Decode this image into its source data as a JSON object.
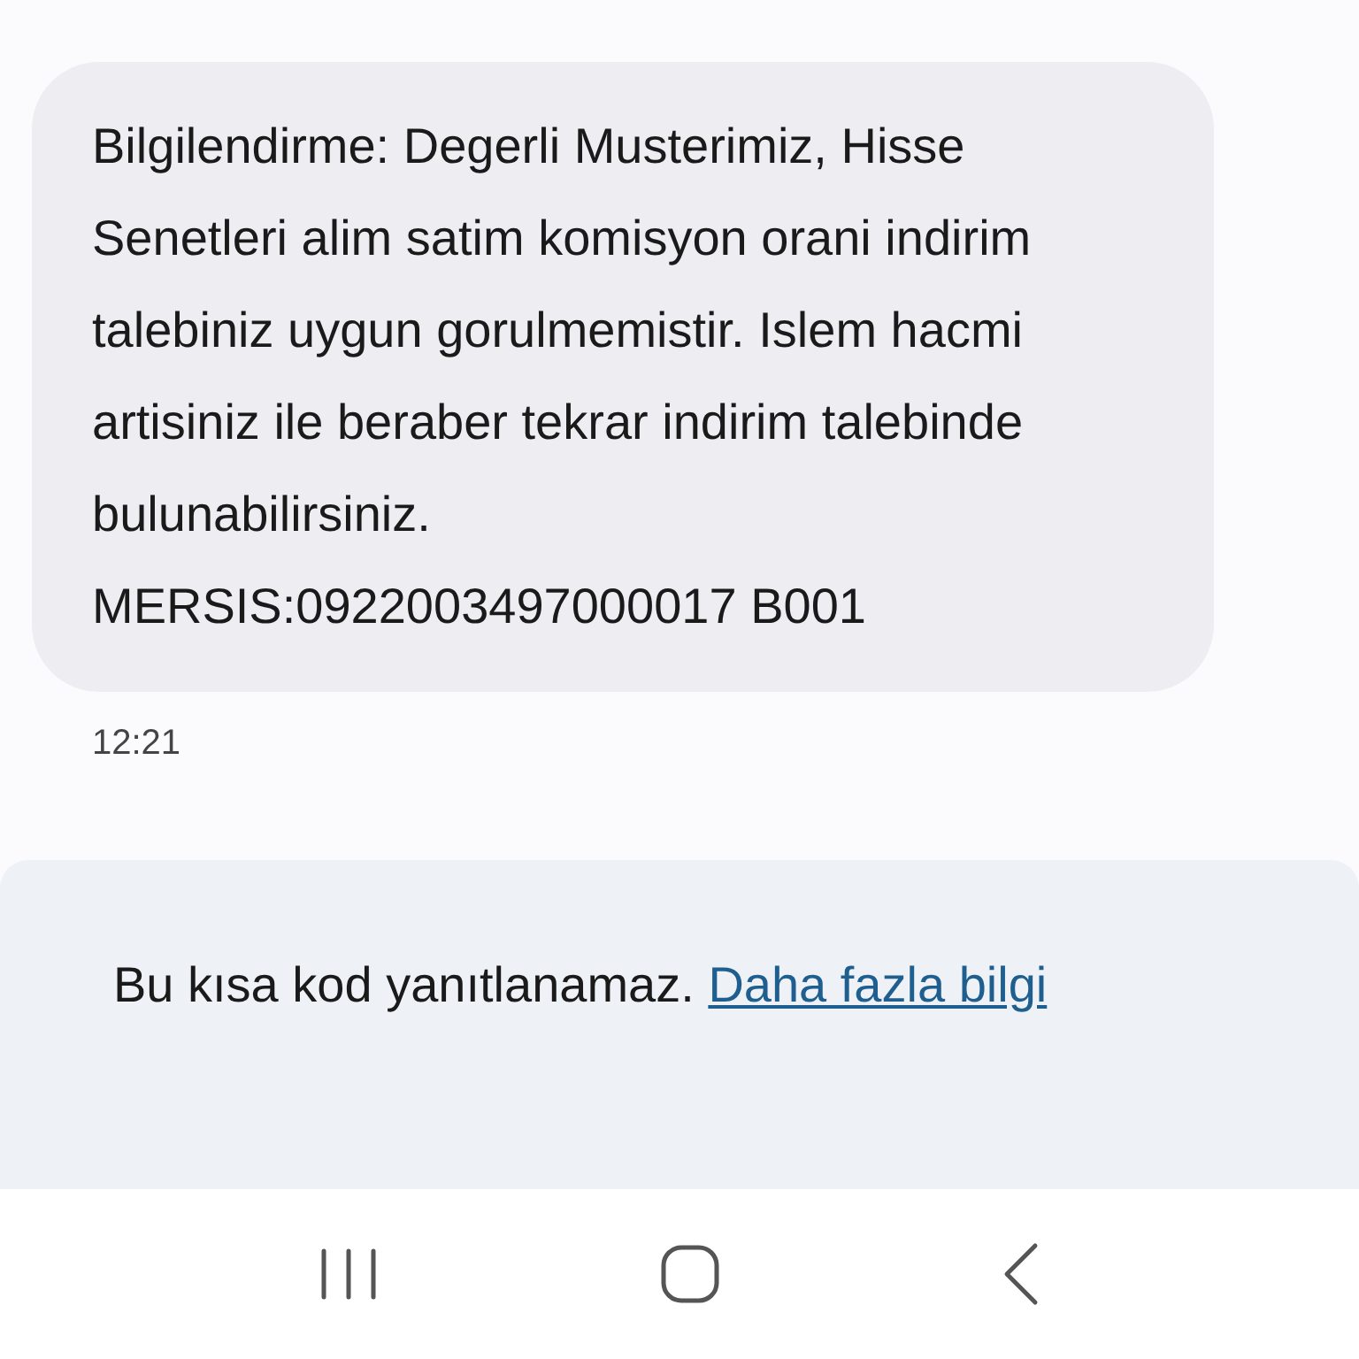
{
  "message": {
    "text": "Bilgilendirme: Degerli Musterimiz, Hisse Senetleri alim satim komisyon orani indirim talebiniz uygun gorulmemistir. Islem hacmi artisiniz ile beraber tekrar indirim talebinde bulunabilirsiniz.\nMERSIS:0922003497000017 B001",
    "time": "12:21"
  },
  "notice": {
    "text": "Bu kısa kod yanıtlanamaz.",
    "link": "Daha fazla bilgi"
  }
}
